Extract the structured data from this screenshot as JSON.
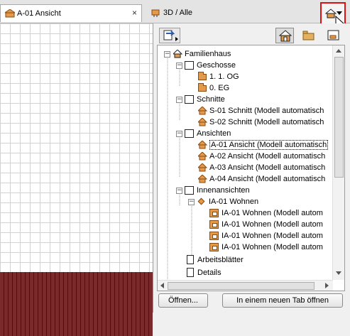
{
  "tabs": {
    "active_label": "A-01 Ansicht",
    "close_glyph": "×",
    "second_label": "3D / Alle"
  },
  "navigator": {
    "tree": {
      "root": "Familienhaus",
      "geschosse": "Geschosse",
      "og": "1. 1. OG",
      "eg": "0. EG",
      "schnitte": "Schnitte",
      "s01": "S-01 Schnitt (Modell automatisch",
      "s02": "S-02 Schnitt (Modell automatisch",
      "ansichten": "Ansichten",
      "a01": "A-01 Ansicht (Modell automatisch",
      "a02": "A-02 Ansicht (Modell automatisch",
      "a03": "A-03 Ansicht (Modell automatisch",
      "a04": "A-04 Ansicht (Modell automatisch",
      "innenansichten": "Innenansichten",
      "ia_group": "IA-01 Wohnen",
      "ia1": "IA-01 Wohnen (Modell autom",
      "ia2": "IA-01 Wohnen (Modell autom",
      "ia3": "IA-01 Wohnen (Modell autom",
      "ia4": "IA-01 Wohnen (Modell autom",
      "arbeitsblaetter": "Arbeitsblätter",
      "details": "Details"
    },
    "buttons": {
      "open": "Öffnen...",
      "new_tab": "In einem neuen Tab öffnen"
    }
  },
  "colors": {
    "highlight_frame": "#e01010",
    "icon_orange": "#e39a4a",
    "building_brick": "#7a2a2a"
  }
}
